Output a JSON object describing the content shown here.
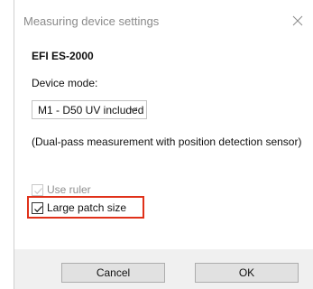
{
  "dialog": {
    "title": "Measuring device settings",
    "close_icon": "close-icon"
  },
  "device": {
    "name": "EFI ES-2000",
    "mode_label": "Device mode:",
    "mode_selected": "M1 - D50 UV included",
    "mode_description": "(Dual-pass measurement with position detection sensor)"
  },
  "options": {
    "use_ruler": {
      "label": "Use ruler",
      "checked": true,
      "enabled": false
    },
    "large_patch": {
      "label": "Large patch size",
      "checked": true,
      "enabled": true
    }
  },
  "buttons": {
    "cancel_label": "Cancel",
    "ok_label": "OK"
  },
  "colors": {
    "highlight": "#e0311a",
    "footer": "#f0f0f0",
    "button_face": "#e1e1e1"
  }
}
